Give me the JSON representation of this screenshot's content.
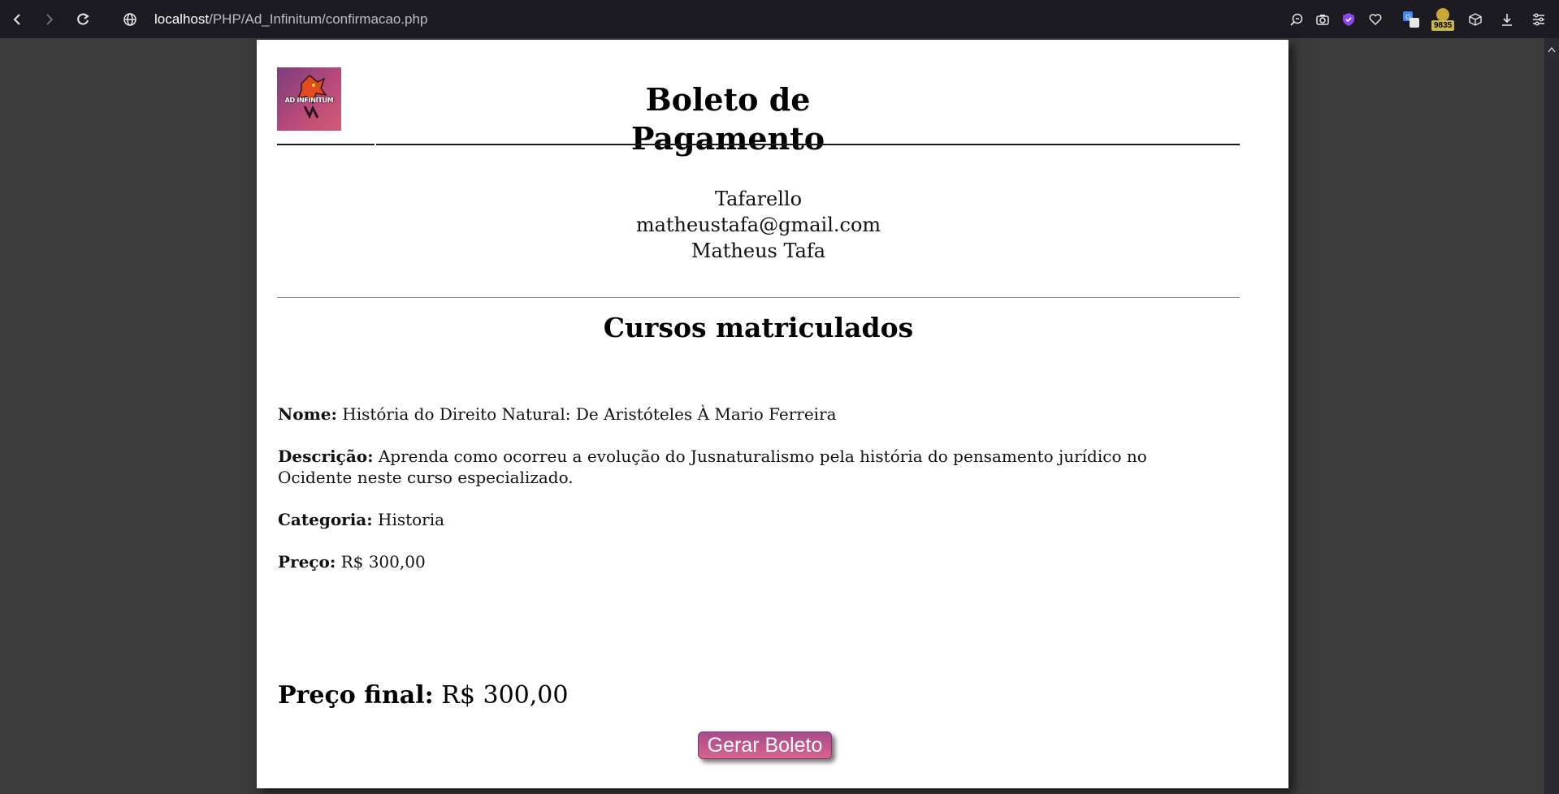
{
  "browser": {
    "url_host": "localhost",
    "url_path": "/PHP/Ad_Infinitum/confirmacao.php",
    "extension_badge": "9835",
    "icons": [
      "back-icon",
      "forward-icon",
      "reload-icon",
      "site-info-icon",
      "zoom-icon",
      "screenshot-icon",
      "shield-icon",
      "heart-icon",
      "translate-icon",
      "extension-icon",
      "box-icon",
      "download-icon",
      "settings-icon"
    ]
  },
  "page": {
    "logo_text": "AD INFINITUM",
    "title": "Boleto de Pagamento",
    "user": {
      "username": "Tafarello",
      "email": "matheustafa@gmail.com",
      "full_name": "Matheus Tafa"
    },
    "courses_heading": "Cursos matriculados",
    "course": {
      "name_label": "Nome:",
      "name": "História do Direito Natural: De Aristóteles À Mario Ferreira",
      "description_label": "Descrição:",
      "description": "Aprenda como ocorreu a evolução do Jusnaturalismo pela história do pensamento jurídico no Ocidente neste curso especializado.",
      "category_label": "Categoria:",
      "category": "Historia",
      "price_label": "Preço:",
      "price": "R$ 300,00"
    },
    "final_price_label": "Preço final:",
    "final_price": "R$ 300,00",
    "generate_button": "Gerar Boleto"
  },
  "colors": {
    "button_gradient_start": "#a64b8a",
    "button_gradient_end": "#d9638e",
    "page_background": "#3b3b3b",
    "toolbar_background": "#1c1b22"
  }
}
